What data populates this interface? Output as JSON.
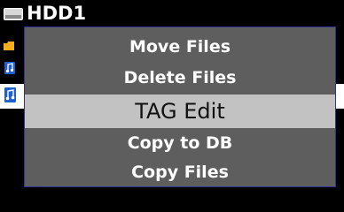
{
  "header": {
    "title": "HDD1",
    "icon": "hdd-icon"
  },
  "colors": {
    "background": "#000000",
    "menu_background": "#5e5e5e",
    "menu_border": "#2e3192",
    "selected_background": "#c2c2c2",
    "selected_text": "#111111",
    "text": "#ffffff"
  },
  "context_menu": {
    "items": [
      {
        "label": "Move Files"
      },
      {
        "label": "Delete Files"
      },
      {
        "label": "TAG Edit",
        "selected": true
      },
      {
        "label": "Copy to DB"
      },
      {
        "label": "Copy Files"
      }
    ]
  }
}
